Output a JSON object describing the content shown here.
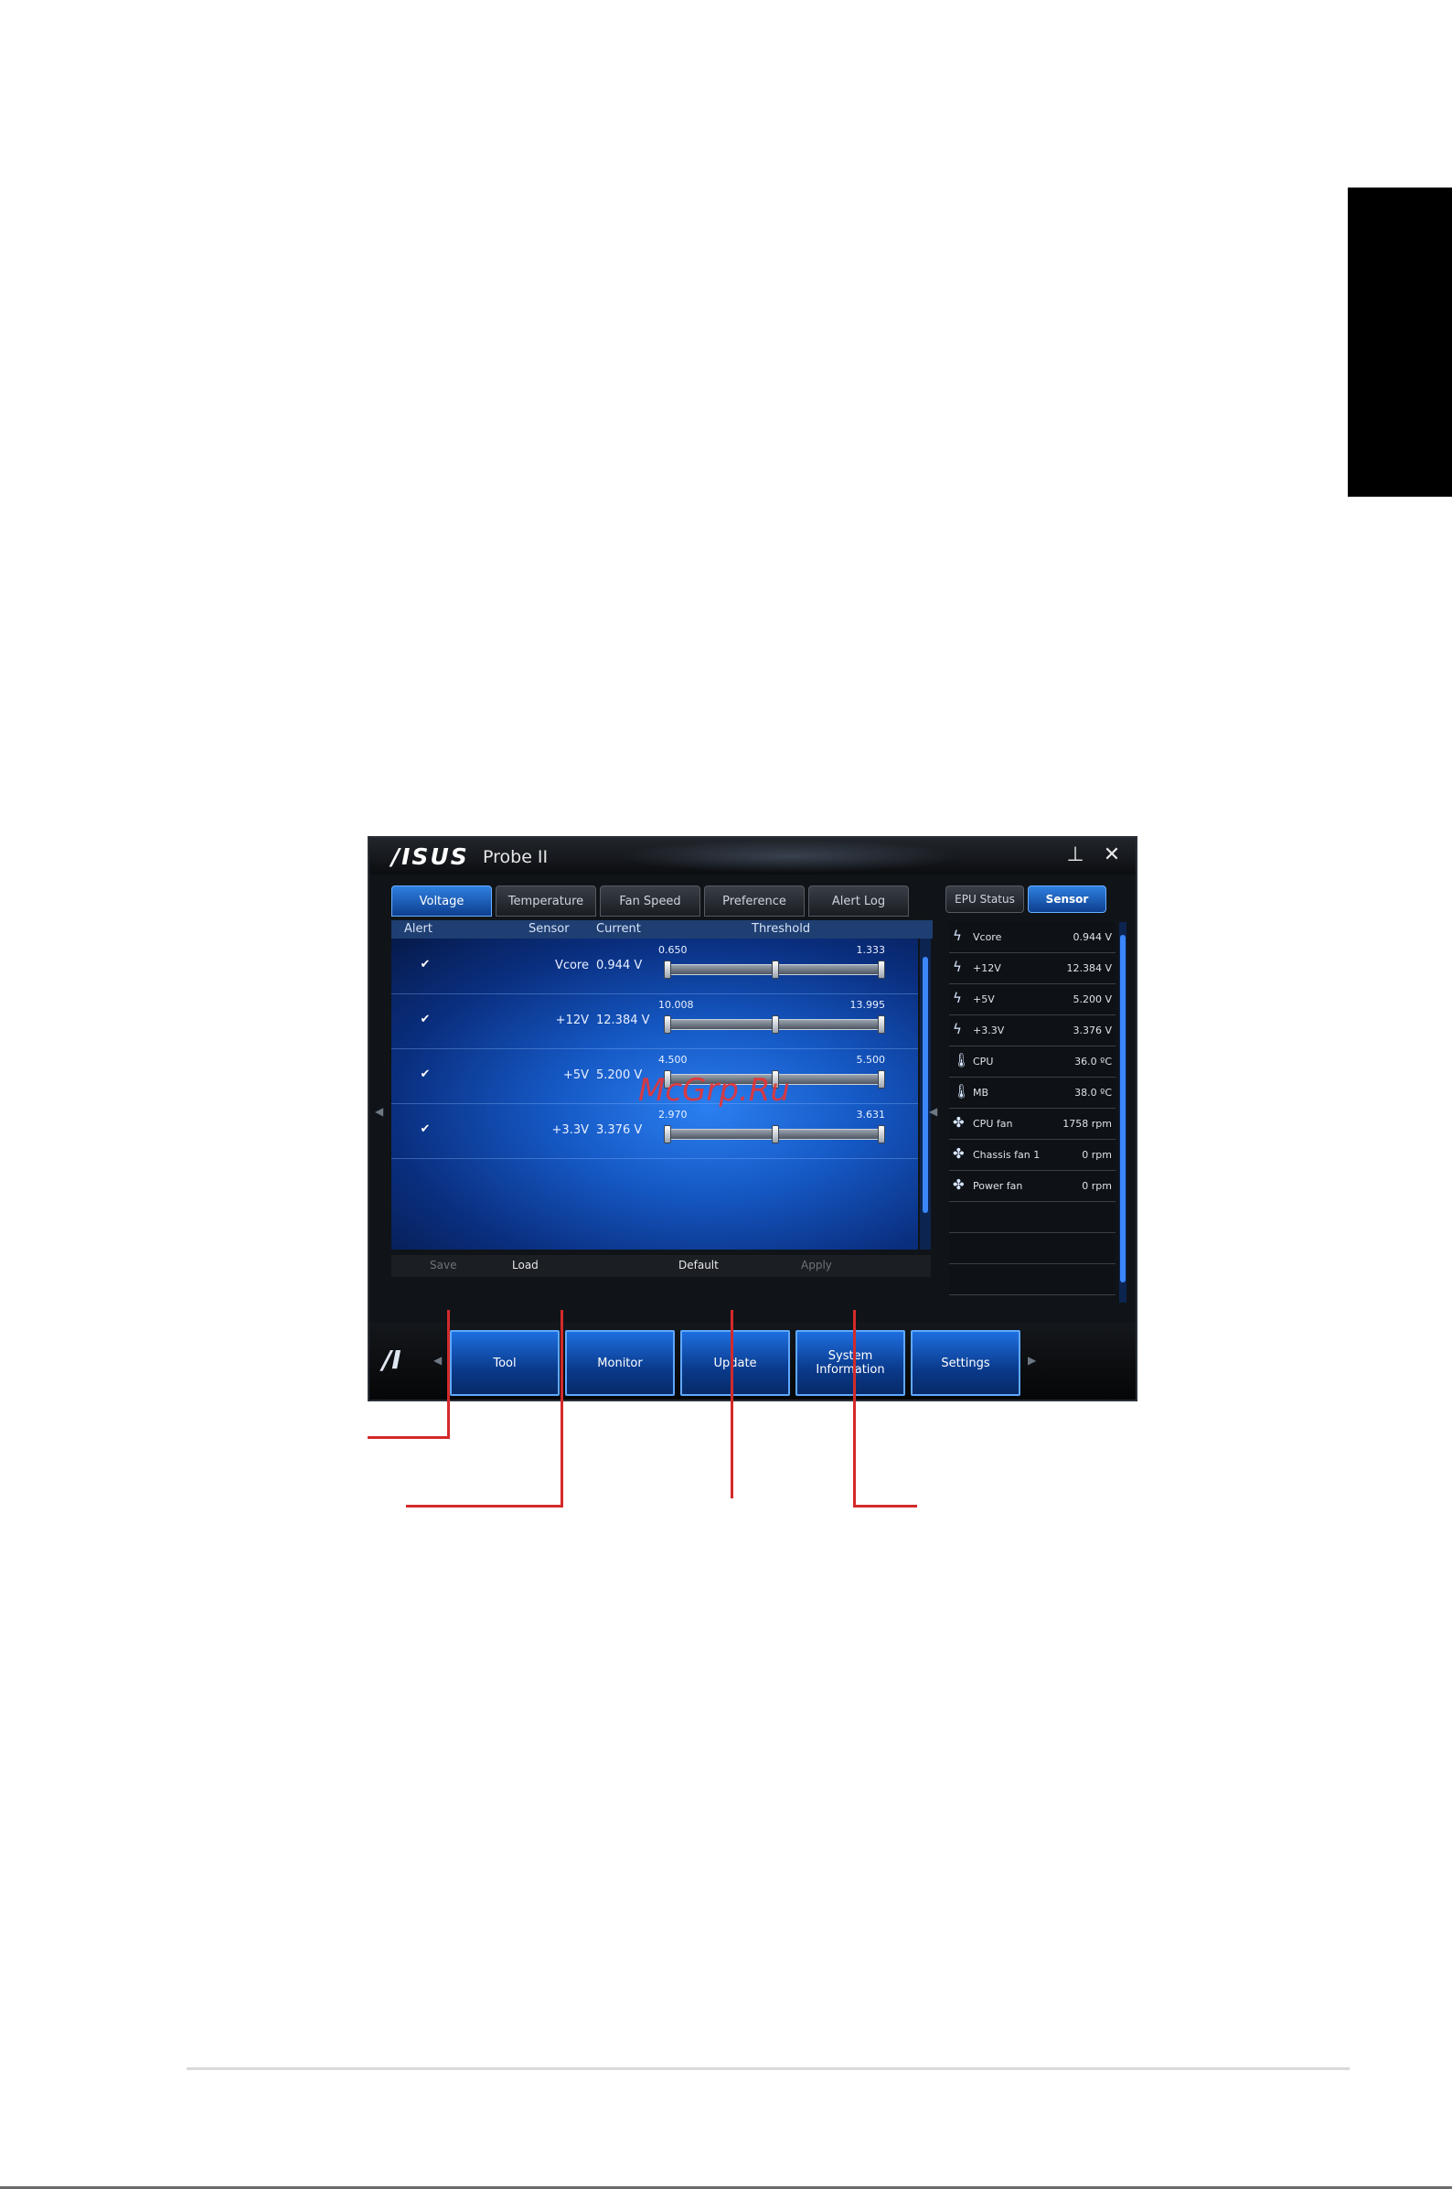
{
  "app": {
    "logo": "/ISUS",
    "title": "Probe II",
    "min_symbol": "⊥",
    "close_symbol": "✕"
  },
  "tabs": [
    "Voltage",
    "Temperature",
    "Fan Speed",
    "Preference",
    "Alert Log"
  ],
  "columns": {
    "alert": "Alert",
    "sensor": "Sensor",
    "current": "Current",
    "threshold": "Threshold"
  },
  "rows": [
    {
      "checked": true,
      "sensor": "Vcore",
      "current": "0.944 V",
      "min": "0.650",
      "max": "1.333"
    },
    {
      "checked": true,
      "sensor": "+12V",
      "current": "12.384 V",
      "min": "10.008",
      "max": "13.995"
    },
    {
      "checked": true,
      "sensor": "+5V",
      "current": "5.200 V",
      "min": "4.500",
      "max": "5.500"
    },
    {
      "checked": true,
      "sensor": "+3.3V",
      "current": "3.376 V",
      "min": "2.970",
      "max": "3.631"
    }
  ],
  "actions": {
    "save": "Save",
    "load": "Load",
    "default": "Default",
    "apply": "Apply"
  },
  "right_tabs": [
    "EPU Status",
    "Sensor"
  ],
  "sensor_list": [
    {
      "icon": "bolt-icon",
      "name": "Vcore",
      "value": "0.944 V"
    },
    {
      "icon": "bolt-icon",
      "name": "+12V",
      "value": "12.384 V"
    },
    {
      "icon": "bolt-icon",
      "name": "+5V",
      "value": "5.200 V"
    },
    {
      "icon": "bolt-icon",
      "name": "+3.3V",
      "value": "3.376 V"
    },
    {
      "icon": "thermometer-icon",
      "name": "CPU",
      "value": "36.0 ºC"
    },
    {
      "icon": "thermometer-icon",
      "name": "MB",
      "value": "38.0 ºC"
    },
    {
      "icon": "fan-icon",
      "name": "CPU fan",
      "value": "1758 rpm"
    },
    {
      "icon": "fan-icon",
      "name": "Chassis fan 1",
      "value": "0 rpm"
    },
    {
      "icon": "fan-icon",
      "name": "Power fan",
      "value": "0 rpm"
    },
    {
      "icon": "",
      "name": "",
      "value": ""
    },
    {
      "icon": "",
      "name": "",
      "value": ""
    },
    {
      "icon": "",
      "name": "",
      "value": ""
    }
  ],
  "nav": [
    "Tool",
    "Monitor",
    "Update",
    "System Information",
    "Settings"
  ],
  "watermark": "McGrp.Ru",
  "colors": {
    "accent": "#2f7fe0",
    "callout": "#d42a2a"
  }
}
